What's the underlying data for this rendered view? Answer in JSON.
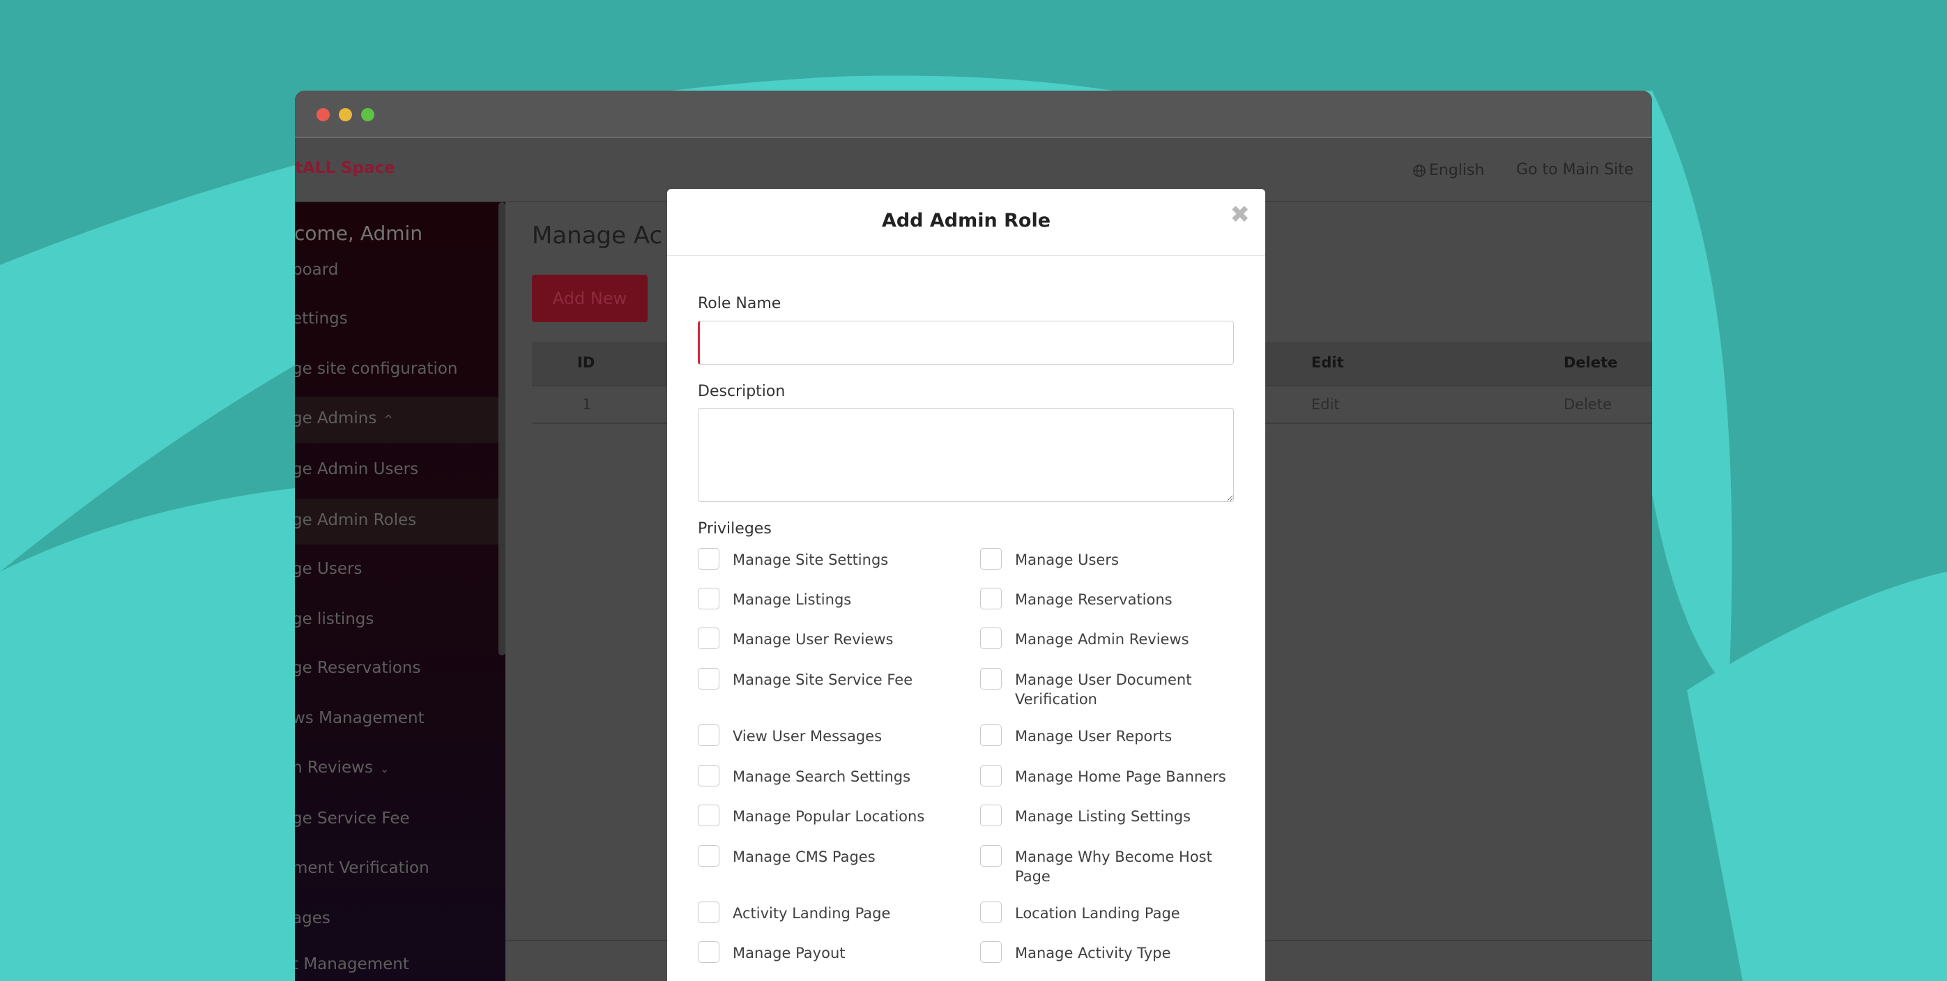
{
  "header": {
    "brand": "tALL Space",
    "language": "English",
    "go_to_main_site": "Go to Main Site"
  },
  "sidebar": {
    "welcome": "elcome, Admin",
    "items": [
      {
        "label": "board",
        "active": false
      },
      {
        "label": "ettings",
        "active": false
      },
      {
        "label": "ge site configuration",
        "active": false
      },
      {
        "label": "ge Admins",
        "active": true,
        "chevron": "^"
      },
      {
        "label": "ge Admin Users",
        "active": false
      },
      {
        "label": "ge Admin Roles",
        "active": true
      },
      {
        "label": "ge Users",
        "active": false
      },
      {
        "label": "ge listings",
        "active": false
      },
      {
        "label": "ge Reservations",
        "active": false
      },
      {
        "label": "ws Management",
        "active": false
      },
      {
        "label": "n Reviews",
        "active": false,
        "chevron": "⌄"
      },
      {
        "label": "ge Service Fee",
        "active": false
      },
      {
        "label": "ment Verification",
        "active": false
      },
      {
        "label": "ages",
        "active": false
      },
      {
        "label": "t Management",
        "active": false
      }
    ]
  },
  "main": {
    "page_title": "Manage Ac",
    "add_new_label": "Add New",
    "table": {
      "headers": {
        "id": "ID",
        "edit": "Edit",
        "delete": "Delete"
      },
      "rows": [
        {
          "id": "1",
          "edit": "Edit",
          "delete": "Delete"
        }
      ]
    }
  },
  "modal": {
    "title": "Add Admin Role",
    "close_symbol": "✖",
    "role_name_label": "Role Name",
    "role_name_value": "",
    "description_label": "Description",
    "description_value": "",
    "privileges_label": "Privileges",
    "privileges": [
      [
        "Manage Site Settings",
        "Manage Users"
      ],
      [
        "Manage Listings",
        "Manage Reservations"
      ],
      [
        "Manage User Reviews",
        "Manage Admin Reviews"
      ],
      [
        "Manage Site Service Fee",
        "Manage User Document Verification"
      ],
      [
        "View User Messages",
        "Manage User Reports"
      ],
      [
        "Manage Search Settings",
        "Manage Home Page Banners"
      ],
      [
        "Manage Popular Locations",
        "Manage Listing Settings"
      ],
      [
        "Manage CMS Pages",
        "Manage Why Become Host Page"
      ],
      [
        "Activity Landing Page",
        "Location Landing Page"
      ],
      [
        "Manage Payout",
        "Manage Activity Type"
      ]
    ]
  },
  "colors": {
    "background": "#3aaba3",
    "accent": "#d7263d",
    "overlay": "#4a4a4a"
  }
}
